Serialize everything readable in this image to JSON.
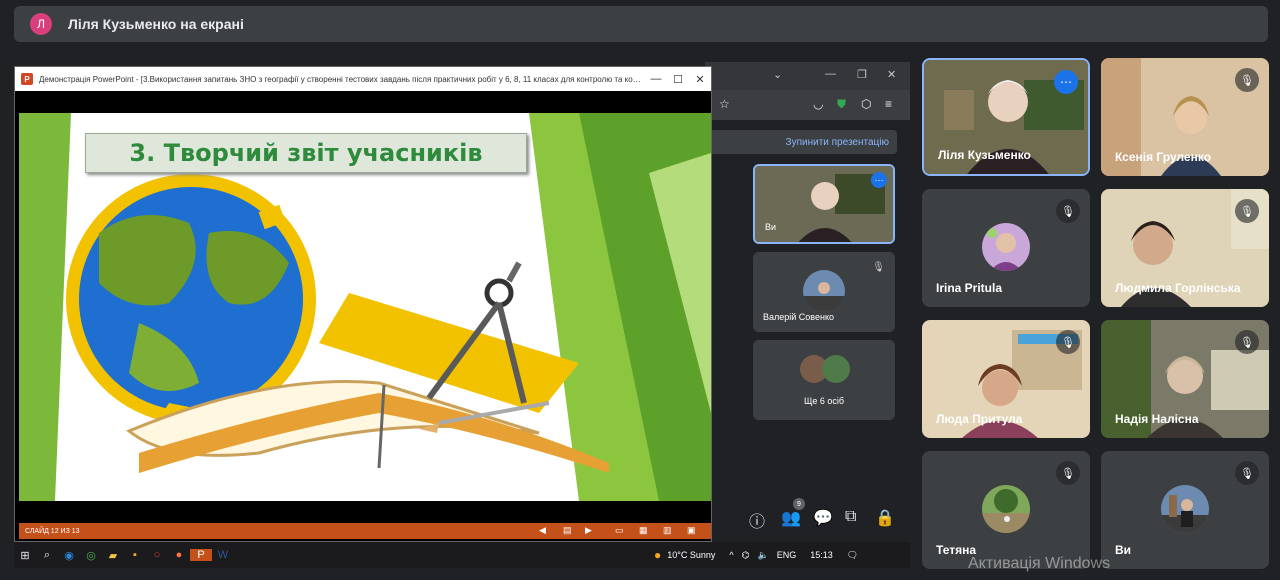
{
  "header": {
    "avatar_letter": "Л",
    "title": "Ліля Кузьменко на екрані"
  },
  "powerpoint": {
    "window_title": "Демонстрація PowerPoint - [3.Використання запитань ЗНО з географії у створенні тестових завдань після практичних робіт у 6, 8, 11 класах для контролю та коригува...",
    "slide_title": "3. Творчий звіт учасників",
    "status": "СЛАЙД 12 ИЗ 13"
  },
  "host_panel": {
    "stop_presentation": "Зупинити презентацію",
    "self_label": "Ви",
    "participant_1": "Валерій Совенко",
    "more_people": "Ще 6 осіб",
    "participants_count": "9"
  },
  "grid": {
    "tiles": [
      {
        "name": "Ліля Кузьменко"
      },
      {
        "name": "Ксенія Груленко"
      },
      {
        "name": "Irina Pritula"
      },
      {
        "name": "Людмила Горлінська"
      },
      {
        "name": "Люда Притула"
      },
      {
        "name": "Надія Налісна"
      },
      {
        "name": "Тетяна"
      },
      {
        "name": "Ви"
      }
    ]
  },
  "taskbar": {
    "weather": "10°C  Sunny",
    "lang": "ENG",
    "time": "15:13"
  },
  "watermark": "Активація Windows",
  "colors": {
    "accent_blue": "#8ab4f8",
    "slide_title_green": "#2e8b3c",
    "pp_orange": "#c4501a"
  }
}
